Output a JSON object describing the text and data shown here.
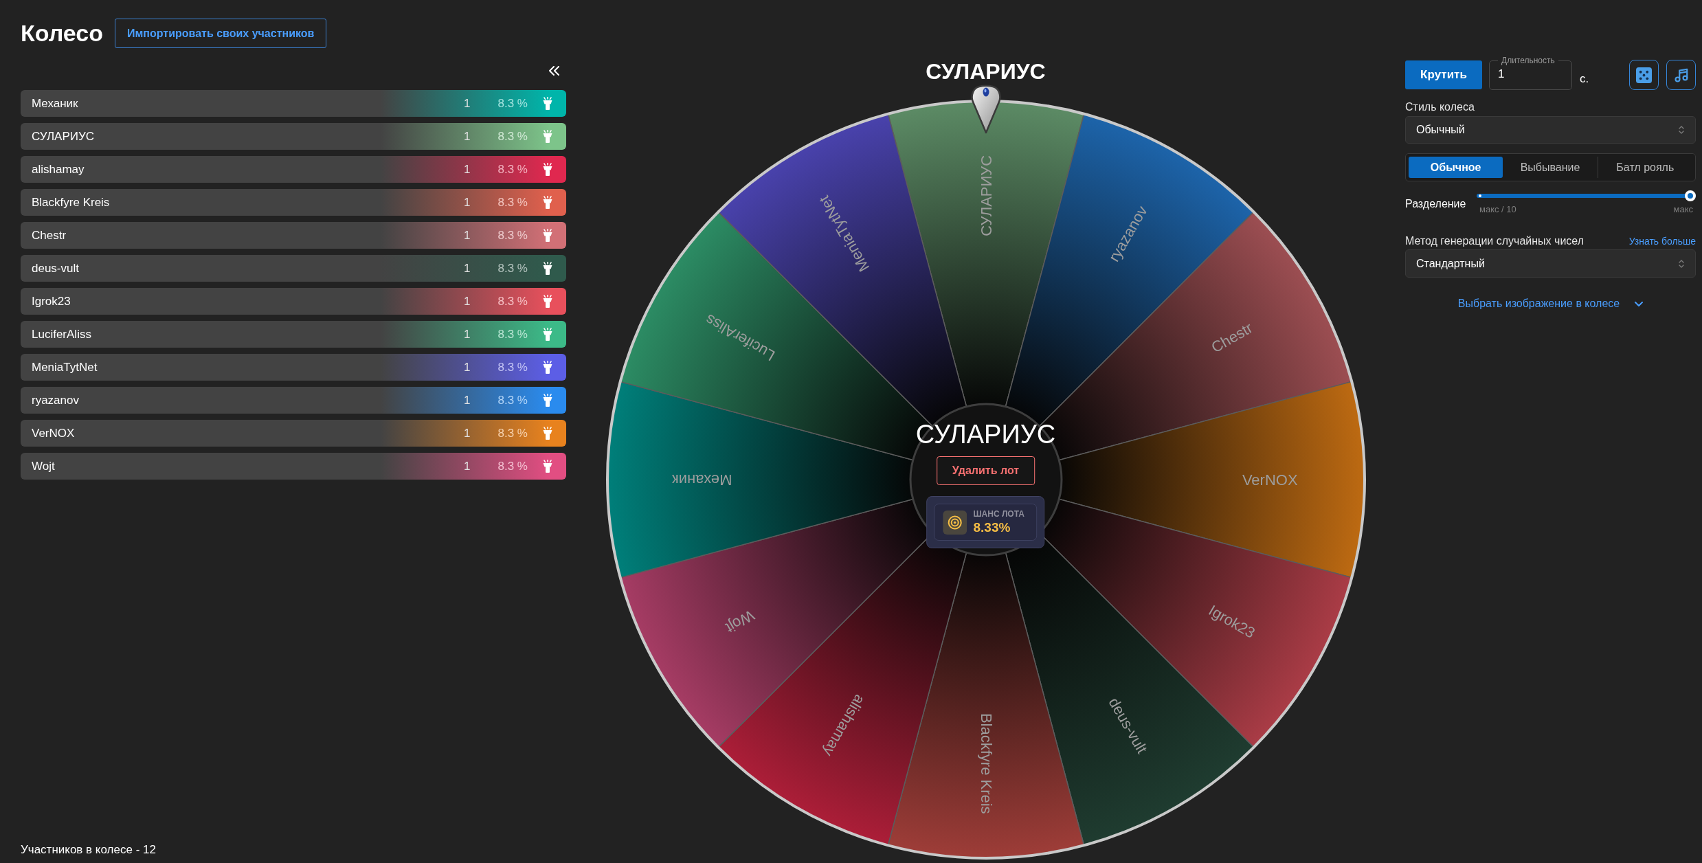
{
  "header": {
    "title": "Колесо",
    "import_button": "Импортировать своих участников"
  },
  "participants": [
    {
      "name": "Механик",
      "count": "1",
      "chance": "8.3 %",
      "color": "#00b5aa"
    },
    {
      "name": "СУЛАРИУС",
      "count": "1",
      "chance": "8.3 %",
      "color": "#7dc48a"
    },
    {
      "name": "alishamay",
      "count": "1",
      "chance": "8.3 %",
      "color": "#e0284f"
    },
    {
      "name": "Blackfyre Kreis",
      "count": "1",
      "chance": "8.3 %",
      "color": "#e0604d"
    },
    {
      "name": "Chestr",
      "count": "1",
      "chance": "8.3 %",
      "color": "#d27076"
    },
    {
      "name": "deus-vult",
      "count": "1",
      "chance": "8.3 %",
      "color": "#2f5a4c"
    },
    {
      "name": "Igrok23",
      "count": "1",
      "chance": "8.3 %",
      "color": "#e8505c"
    },
    {
      "name": "LuciferAliss",
      "count": "1",
      "chance": "8.3 %",
      "color": "#3cba88"
    },
    {
      "name": "MeniaTytNet",
      "count": "1",
      "chance": "8.3 %",
      "color": "#5c5ee6"
    },
    {
      "name": "ryazanov",
      "count": "1",
      "chance": "8.3 %",
      "color": "#2a8bee"
    },
    {
      "name": "VerNOX",
      "count": "1",
      "chance": "8.3 %",
      "color": "#e8821e"
    },
    {
      "name": "Wojt",
      "count": "1",
      "chance": "8.3 %",
      "color": "#e24e82"
    }
  ],
  "participants_total": "Участников в колесе - 12",
  "wheel": {
    "winner": "СУЛАРИУС",
    "segments": [
      {
        "label": "СУЛАРИУС",
        "color": "#5c8b65"
      },
      {
        "label": "ryazanov",
        "color": "#1d64aa"
      },
      {
        "label": "Chestr",
        "color": "#9c4e52"
      },
      {
        "label": "VerNOX",
        "color": "#bd6a12"
      },
      {
        "label": "Igrok23",
        "color": "#aa3c46"
      },
      {
        "label": "deus-vult",
        "color": "#1f3c30"
      },
      {
        "label": "Blackfyre Kreis",
        "color": "#9e3d38"
      },
      {
        "label": "alishamay",
        "color": "#ac1e38"
      },
      {
        "label": "Wojt",
        "color": "#a63c64"
      },
      {
        "label": "Механик",
        "color": "#007f7a"
      },
      {
        "label": "LuciferAliss",
        "color": "#2c8c64"
      },
      {
        "label": "MeniaTytNet",
        "color": "#4942ac"
      }
    ],
    "center": {
      "title": "СУЛАРИУС",
      "delete_button": "Удалить лот",
      "chance_label": "ШАНС ЛОТА",
      "chance_value": "8.33%"
    }
  },
  "controls": {
    "spin_button": "Крутить",
    "duration": {
      "label": "Длительность",
      "value": "1",
      "unit": "с."
    },
    "style": {
      "label": "Стиль колеса",
      "value": "Обычный"
    },
    "modes": [
      {
        "label": "Обычное",
        "selected": true
      },
      {
        "label": "Выбывание",
        "selected": false
      },
      {
        "label": "Батл рояль",
        "selected": false
      }
    ],
    "split": {
      "label": "Разделение",
      "level": 1,
      "min_label": "макс / 10",
      "max_label": "макс"
    },
    "rng": {
      "label": "Метод генерации случайных чисел",
      "link": "Узнать больше",
      "value": "Стандартный"
    },
    "image_picker": "Выбрать изображение в колесе"
  }
}
